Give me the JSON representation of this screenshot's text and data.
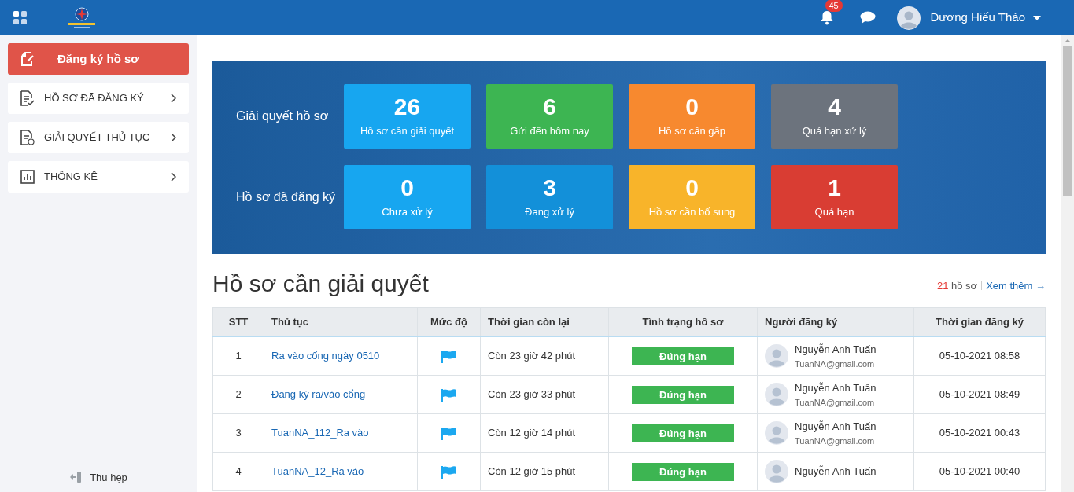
{
  "header": {
    "notification_count": "45",
    "user_name": "Dương Hiếu Thảo"
  },
  "sidebar": {
    "primary_button": "Đăng ký hồ sơ",
    "items": [
      {
        "label": "HỒ SƠ ĐÃ ĐĂNG KÝ",
        "kind": "check"
      },
      {
        "label": "GIẢI QUYẾT THỦ TỤC",
        "kind": "clock"
      },
      {
        "label": "THỐNG KÊ",
        "kind": "chart"
      }
    ],
    "collapse": "Thu hẹp"
  },
  "summary": [
    {
      "label": "Giải quyết hồ sơ",
      "tiles": [
        {
          "value": "26",
          "label": "Hồ sơ cần giải quyết",
          "color": "#17a6f0"
        },
        {
          "value": "6",
          "label": "Gửi đến hôm nay",
          "color": "#3db552"
        },
        {
          "value": "0",
          "label": "Hồ sơ cần gấp",
          "color": "#f7892f"
        },
        {
          "value": "4",
          "label": "Quá hạn xử lý",
          "color": "#6c737d"
        }
      ]
    },
    {
      "label": "Hồ sơ đã đăng ký",
      "tiles": [
        {
          "value": "0",
          "label": "Chưa xử lý",
          "color": "#17a6f0"
        },
        {
          "value": "3",
          "label": "Đang xử lý",
          "color": "#1390d9"
        },
        {
          "value": "0",
          "label": "Hồ sơ cần bổ sung",
          "color": "#f8b42a"
        },
        {
          "value": "1",
          "label": "Quá hạn",
          "color": "#d93d33"
        }
      ]
    }
  ],
  "list": {
    "title": "Hồ sơ cần giải quyết",
    "count": "21",
    "count_unit": "hồ sơ",
    "more": "Xem thêm →",
    "columns": [
      "STT",
      "Thủ tục",
      "Mức độ",
      "Thời gian còn lại",
      "Tình trạng hồ sơ",
      "Người đăng ký",
      "Thời gian đăng ký"
    ],
    "rows": [
      {
        "index": "1",
        "procedure": "Ra vào cổng ngày 0510",
        "remaining": "Còn 23 giờ 42 phút",
        "status": "Đúng hạn",
        "name": "Nguyễn Anh Tuấn",
        "email": "TuanNA@gmail.com",
        "time": "05-10-2021 08:58"
      },
      {
        "index": "2",
        "procedure": "Đăng ký ra/vào cổng",
        "remaining": "Còn 23 giờ 33 phút",
        "status": "Đúng hạn",
        "name": "Nguyễn Anh Tuấn",
        "email": "TuanNA@gmail.com",
        "time": "05-10-2021 08:49"
      },
      {
        "index": "3",
        "procedure": "TuanNA_112_Ra vào",
        "remaining": "Còn 12 giờ 14 phút",
        "status": "Đúng hạn",
        "name": "Nguyễn Anh Tuấn",
        "email": "TuanNA@gmail.com",
        "time": "05-10-2021 00:43"
      },
      {
        "index": "4",
        "procedure": "TuanNA_12_Ra vào",
        "remaining": "Còn 12 giờ 15 phút",
        "status": "Đúng hạn",
        "name": "Nguyễn Anh Tuấn",
        "time": "05-10-2021 00:40"
      }
    ]
  }
}
